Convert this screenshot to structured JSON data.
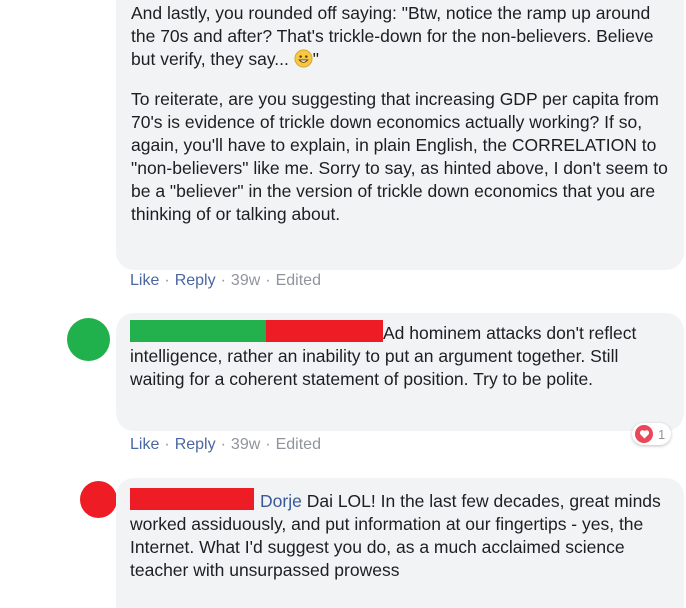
{
  "comment1": {
    "para1": "And lastly, you rounded off saying: \"Btw, notice the ramp up around the 70s and after? That's trickle-down for the non-believers. Believe but verify, they say...",
    "para1_end": "\"",
    "para2": "To reiterate, are you suggesting that increasing GDP per capita from 70's is evidence of trickle down economics actually working? If so, again, you'll have to explain, in plain English, the CORRELATION to \"non-believers\" like me. Sorry to say, as hinted above, I don't seem to be a \"believer\" in the version of trickle down economics that you are thinking of or talking about.",
    "emoji_icon": "grin-emoji-icon",
    "actions": {
      "like": "Like",
      "reply": "Reply",
      "time": "39w",
      "edited": "Edited"
    }
  },
  "comment2": {
    "avatar_color": "#21b14c",
    "redact_colors": [
      "#22b14c",
      "#ee1c24"
    ],
    "text": "Ad hominem attacks don't reflect intelligence, rather an inability to put an argument together. Still waiting for a coherent statement of position. Try to be polite.",
    "actions": {
      "like": "Like",
      "reply": "Reply",
      "time": "39w",
      "edited": "Edited"
    },
    "reaction": {
      "icon": "heart-icon",
      "count": "1"
    }
  },
  "comment3": {
    "avatar_color": "#ee1c24",
    "redact_color": "#ee1c24",
    "mention": "Dorje",
    "text": "Dai LOL! In the last few decades, great minds worked assiduously, and put information at our fingertips - yes, the Internet. What I'd suggest you do, as a much acclaimed science teacher with unsurpassed prowess"
  },
  "separator": "·"
}
